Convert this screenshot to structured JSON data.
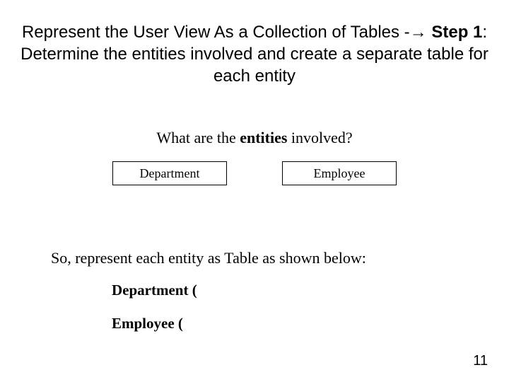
{
  "title": {
    "prefix": "Represent the User View As a Collection of Tables -",
    "arrow": "→",
    "step": "Step 1",
    "colon": ": Determine the entities involved and create a separate table for each entity"
  },
  "question": {
    "prefix": "What are the ",
    "emph": "entities",
    "suffix": " involved?"
  },
  "entities": {
    "first": "Department",
    "second": "Employee"
  },
  "represent": "So, represent each entity as Table as shown below:",
  "tables": {
    "first": "Department (",
    "second": "Employee ("
  },
  "pagenum": "11"
}
